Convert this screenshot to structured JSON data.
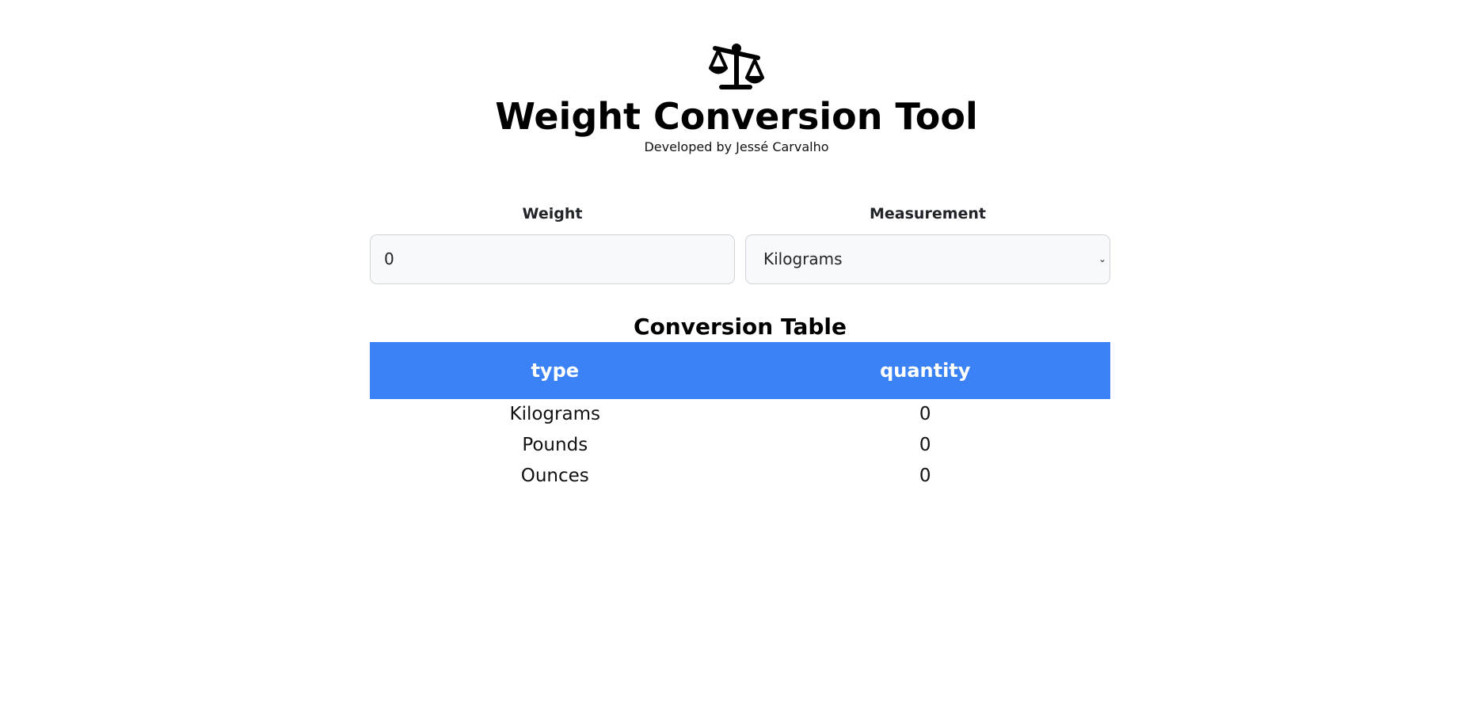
{
  "header": {
    "icon": "scale-balance-icon",
    "title": "Weight Conversion Tool",
    "subtitle": "Developed by Jessé Carvalho"
  },
  "form": {
    "weight_label": "Weight",
    "weight_value": "0",
    "measurement_label": "Measurement",
    "measurement_selected": "Kilograms",
    "input_background": "#f8f9fa",
    "input_border": "#ced4da"
  },
  "table": {
    "title": "Conversion Table",
    "columns": [
      "type",
      "quantity"
    ],
    "header_background": "#3b82f6",
    "rows": [
      {
        "type": "Kilograms",
        "quantity": "0"
      },
      {
        "type": "Pounds",
        "quantity": "0"
      },
      {
        "type": "Ounces",
        "quantity": "0"
      }
    ]
  }
}
